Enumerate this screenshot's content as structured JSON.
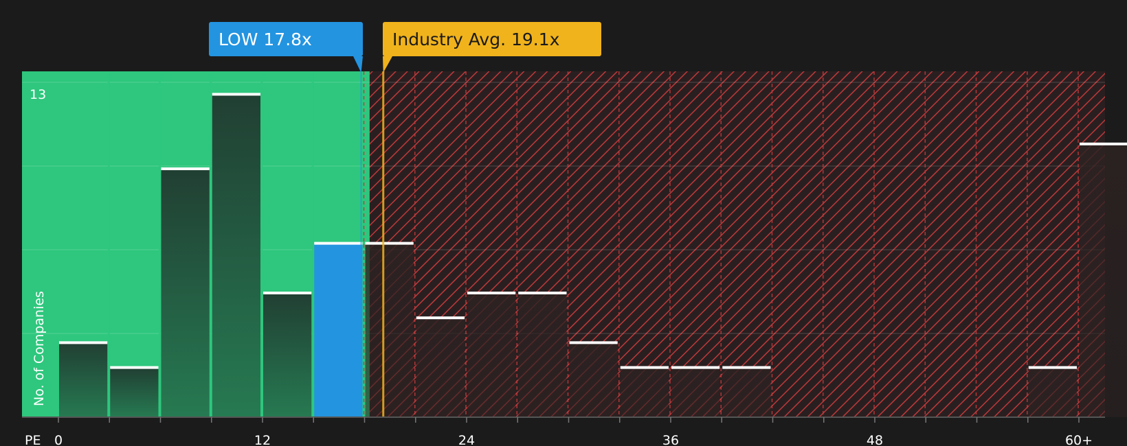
{
  "chart_data": {
    "type": "bar",
    "xlabel": "PE",
    "ylabel": "No. of Companies",
    "ylim": [
      0,
      13.5
    ],
    "y_tick_labels": [
      "13"
    ],
    "x_tick_labels": [
      "0",
      "12",
      "24",
      "36",
      "48",
      "60+"
    ],
    "x_tick_values": [
      0,
      12,
      24,
      36,
      48,
      60
    ],
    "bin_width": 3,
    "bins": [
      {
        "start": 0,
        "value": 3
      },
      {
        "start": 3,
        "value": 2
      },
      {
        "start": 6,
        "value": 10
      },
      {
        "start": 9,
        "value": 13
      },
      {
        "start": 12,
        "value": 5
      },
      {
        "start": 15,
        "value": 7,
        "highlight": true
      },
      {
        "start": 18,
        "value": 7
      },
      {
        "start": 21,
        "value": 4
      },
      {
        "start": 24,
        "value": 5
      },
      {
        "start": 27,
        "value": 5
      },
      {
        "start": 30,
        "value": 3
      },
      {
        "start": 33,
        "value": 2
      },
      {
        "start": 36,
        "value": 2
      },
      {
        "start": 39,
        "value": 2
      },
      {
        "start": 42,
        "value": 0
      },
      {
        "start": 45,
        "value": 0
      },
      {
        "start": 48,
        "value": 0
      },
      {
        "start": 51,
        "value": 0
      },
      {
        "start": 54,
        "value": 0
      },
      {
        "start": 57,
        "value": 2
      },
      {
        "start": 60,
        "value": 11
      }
    ],
    "markers": [
      {
        "label": "LOW 17.8x",
        "value": 17.8,
        "color": "#2394e0"
      },
      {
        "label": "Industry Avg. 19.1x",
        "value": 19.1,
        "color": "#f0b31c"
      }
    ],
    "undervalued_max": 18.3,
    "colors": {
      "background": "#1b1b1b",
      "green_zone": "#2ec77d",
      "red_hatch": "#c0393b",
      "bar_dark": "#214836",
      "highlight_bar": "#2394e0",
      "bar_cap": "#ffffff"
    }
  }
}
